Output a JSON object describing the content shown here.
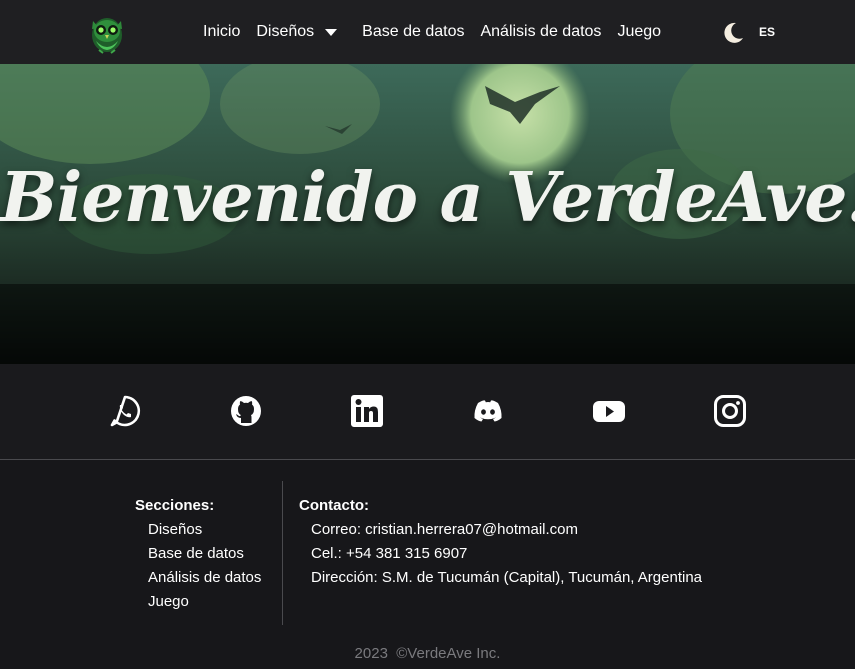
{
  "navbar": {
    "logo_icon": "owl-logo-icon",
    "links": [
      {
        "label": "Inicio"
      },
      {
        "label": "Diseños",
        "dropdown": true
      },
      {
        "label": "Base de datos"
      },
      {
        "label": "Análisis de datos"
      },
      {
        "label": "Juego"
      }
    ],
    "theme_icon": "moon-icon",
    "language": "ES"
  },
  "hero": {
    "title": "Bienvenido a VerdeAve!"
  },
  "social": {
    "icons": [
      "whatsapp-icon",
      "github-icon",
      "linkedin-icon",
      "discord-icon",
      "youtube-icon",
      "instagram-icon"
    ]
  },
  "footer": {
    "sections": {
      "title": "Secciones:",
      "items": [
        "Diseños",
        "Base de datos",
        "Análisis de datos",
        "Juego"
      ]
    },
    "contact": {
      "title": "Contacto:",
      "items": [
        "Correo: cristian.herrera07@hotmail.com",
        "Cel.: +54 381 315 6907",
        "Dirección: S.M. de Tucumán (Capital), Tucumán, Argentina"
      ]
    },
    "copyright": "2023  ©VerdeAve Inc."
  },
  "colors": {
    "background": "#17171a",
    "navbar": "#1f1f22",
    "accent_green": "#3fa84a",
    "text": "#ffffff",
    "muted": "#7a7a7e"
  }
}
